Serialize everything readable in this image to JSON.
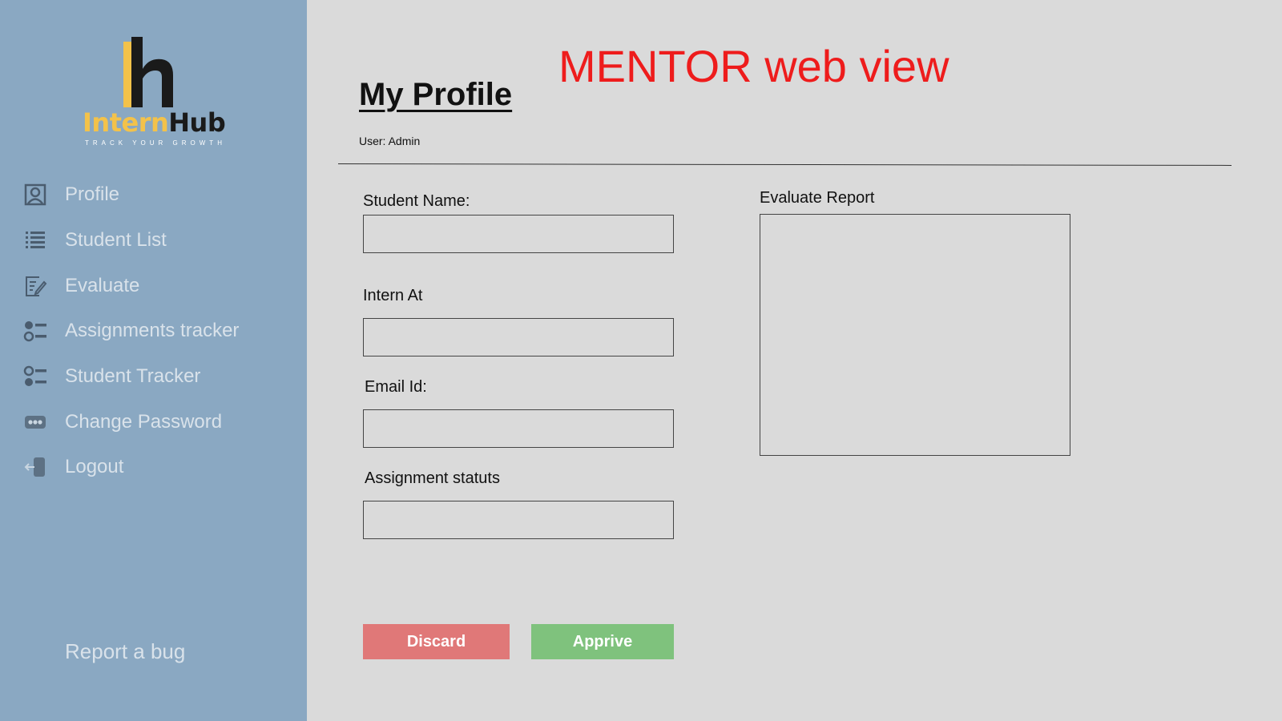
{
  "logo": {
    "word_part1": "Intern",
    "word_part2": "Hub",
    "tagline": "TRACK YOUR GROWTH"
  },
  "sidebar": {
    "items": [
      {
        "label": "Profile",
        "icon": "profile-icon"
      },
      {
        "label": "Student List",
        "icon": "list-icon"
      },
      {
        "label": "Evaluate",
        "icon": "evaluate-icon"
      },
      {
        "label": "Assignments tracker",
        "icon": "tracker-icon"
      },
      {
        "label": "Student Tracker",
        "icon": "tracker-icon"
      },
      {
        "label": "Change Password",
        "icon": "password-icon"
      },
      {
        "label": "Logout",
        "icon": "logout-icon"
      }
    ],
    "report_bug": "Report a bug"
  },
  "header": {
    "title": "My Profile",
    "view_label": "MENTOR web view",
    "user": "User: Admin"
  },
  "form": {
    "student_name_label": "Student Name:",
    "intern_at_label": "Intern At",
    "email_label": "Email Id:",
    "assignment_status_label": "Assignment statuts",
    "evaluate_report_label": "Evaluate Report",
    "student_name_value": "",
    "intern_at_value": "",
    "email_value": "",
    "assignment_status_value": "",
    "evaluate_report_value": ""
  },
  "actions": {
    "discard_label": "Discard",
    "approve_label": "Apprive"
  },
  "colors": {
    "sidebar_bg": "#8aa8c2",
    "main_bg": "#dadada",
    "accent_yellow": "#f3c24a",
    "view_label_red": "#ee1c1c",
    "discard": "#e07878",
    "approve": "#7fc27d"
  }
}
